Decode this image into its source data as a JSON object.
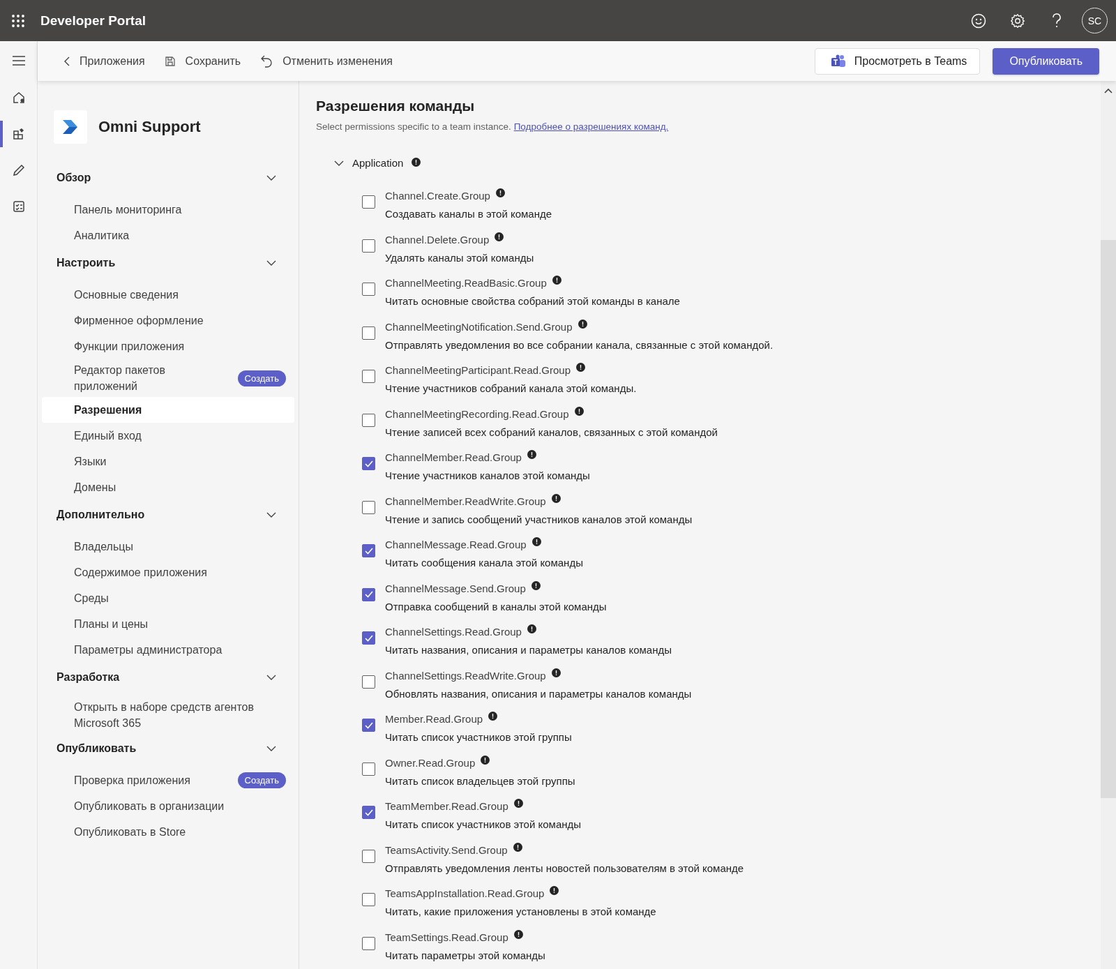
{
  "header": {
    "title": "Developer Portal",
    "avatar": "SC"
  },
  "command_bar": {
    "back": "Приложения",
    "save": "Сохранить",
    "discard": "Отменить изменения",
    "preview": "Просмотреть в Teams",
    "publish": "Опубликовать"
  },
  "rail": [
    {
      "kind": "home",
      "selected": false
    },
    {
      "kind": "apps",
      "selected": true
    },
    {
      "kind": "tools",
      "selected": false
    },
    {
      "kind": "checklist",
      "selected": false
    }
  ],
  "sidebar": {
    "app_name": "Omni Support",
    "sections": [
      {
        "title": "Обзор",
        "expanded": true,
        "items": [
          {
            "label": "Панель мониторинга",
            "selected": false
          },
          {
            "label": "Аналитика",
            "selected": false
          }
        ]
      },
      {
        "title": "Настроить",
        "expanded": true,
        "items": [
          {
            "label": "Основные сведения",
            "selected": false
          },
          {
            "label": "Фирменное оформление",
            "selected": false
          },
          {
            "label": "Функции приложения",
            "selected": false
          },
          {
            "label": "Редактор пакетов приложений",
            "selected": false,
            "badge": "Создать"
          },
          {
            "label": "Разрешения",
            "selected": true
          },
          {
            "label": "Единый вход",
            "selected": false
          },
          {
            "label": "Языки",
            "selected": false
          },
          {
            "label": "Домены",
            "selected": false
          }
        ]
      },
      {
        "title": "Дополнительно",
        "expanded": true,
        "items": [
          {
            "label": "Владельцы",
            "selected": false
          },
          {
            "label": "Содержимое приложения",
            "selected": false
          },
          {
            "label": "Среды",
            "selected": false
          },
          {
            "label": "Планы и цены",
            "selected": false
          },
          {
            "label": "Параметры администратора",
            "selected": false
          }
        ]
      },
      {
        "title": "Разработка",
        "expanded": true,
        "items": [
          {
            "label": "Открыть в наборе средств агентов Microsoft 365",
            "selected": false
          }
        ]
      },
      {
        "title": "Опубликовать",
        "expanded": true,
        "items": [
          {
            "label": "Проверка приложения",
            "selected": false,
            "badge": "Создать"
          },
          {
            "label": "Опубликовать в организации",
            "selected": false
          },
          {
            "label": "Опубликовать в Store",
            "selected": false
          }
        ]
      }
    ]
  },
  "content": {
    "title": "Разрешения команды",
    "subtitle": "Select permissions specific to a team instance.",
    "link": "Подробнее о разрешениях команд.",
    "group": {
      "label": "Application",
      "expanded": true,
      "permissions": [
        {
          "name": "Channel.Create.Group",
          "description": "Создавать каналы в этой команде",
          "checked": false
        },
        {
          "name": "Channel.Delete.Group",
          "description": "Удалять каналы этой команды",
          "checked": false
        },
        {
          "name": "ChannelMeeting.ReadBasic.Group",
          "description": "Читать основные свойства собраний этой команды в канале",
          "checked": false
        },
        {
          "name": "ChannelMeetingNotification.Send.Group",
          "description": "Отправлять уведомления во все собрании канала, связанные с этой командой.",
          "checked": false
        },
        {
          "name": "ChannelMeetingParticipant.Read.Group",
          "description": "Чтение участников собраний канала этой команды.",
          "checked": false
        },
        {
          "name": "ChannelMeetingRecording.Read.Group",
          "description": "Чтение записей всех собраний каналов, связанных с этой командой",
          "checked": false
        },
        {
          "name": "ChannelMember.Read.Group",
          "description": "Чтение участников каналов этой команды",
          "checked": true
        },
        {
          "name": "ChannelMember.ReadWrite.Group",
          "description": "Чтение и запись сообщений участников каналов этой команды",
          "checked": false
        },
        {
          "name": "ChannelMessage.Read.Group",
          "description": "Читать сообщения канала этой команды",
          "checked": true
        },
        {
          "name": "ChannelMessage.Send.Group",
          "description": "Отправка сообщений в каналы этой команды",
          "checked": true
        },
        {
          "name": "ChannelSettings.Read.Group",
          "description": "Читать названия, описания и параметры каналов команды",
          "checked": true
        },
        {
          "name": "ChannelSettings.ReadWrite.Group",
          "description": "Обновлять названия, описания и параметры каналов команды",
          "checked": false
        },
        {
          "name": "Member.Read.Group",
          "description": "Читать список участников этой группы",
          "checked": true
        },
        {
          "name": "Owner.Read.Group",
          "description": "Читать список владельцев этой группы",
          "checked": false
        },
        {
          "name": "TeamMember.Read.Group",
          "description": "Читать список участников этой команды",
          "checked": true
        },
        {
          "name": "TeamsActivity.Send.Group",
          "description": "Отправлять уведомления ленты новостей пользователям в этой команде",
          "checked": false
        },
        {
          "name": "TeamsAppInstallation.Read.Group",
          "description": "Читать, какие приложения установлены в этой команде",
          "checked": false
        },
        {
          "name": "TeamSettings.Read.Group",
          "description": "Читать параметры этой команды",
          "checked": false
        }
      ]
    }
  }
}
